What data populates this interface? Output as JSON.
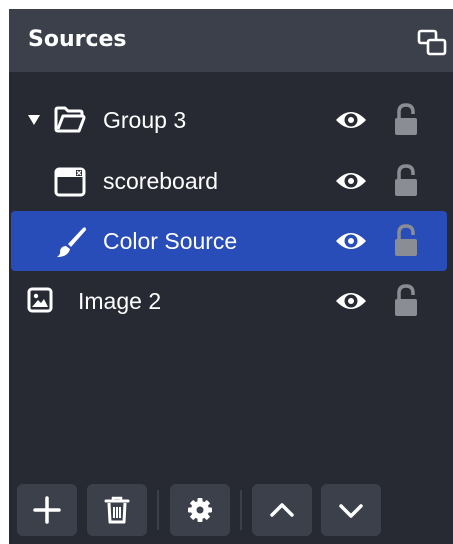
{
  "dock": {
    "title": "Sources",
    "undock_icon": "undock-icon"
  },
  "sources": [
    {
      "label": "Group 3",
      "icon": "folder-icon",
      "expander": "triangle-down-icon",
      "visible": true,
      "locked": false,
      "selected": false
    },
    {
      "label": "scoreboard",
      "icon": "window-icon",
      "visible": true,
      "locked": false,
      "selected": false
    },
    {
      "label": "Color Source",
      "icon": "brush-icon",
      "visible": true,
      "locked": false,
      "selected": true
    },
    {
      "label": "Image 2",
      "icon": "image-icon",
      "visible": true,
      "locked": false,
      "selected": false
    }
  ],
  "toolbar": [
    {
      "name": "add-source-button",
      "icon": "plus-icon"
    },
    {
      "name": "remove-source-button",
      "icon": "trash-icon"
    },
    {
      "name": "source-properties-button",
      "icon": "gear-icon"
    },
    {
      "name": "move-up-button",
      "icon": "chevron-up-icon"
    },
    {
      "name": "move-down-button",
      "icon": "chevron-down-icon"
    }
  ],
  "colors": {
    "dock_bg": "#272a33",
    "header_bg": "#3c404b",
    "selected_row": "#284cb8",
    "text": "#fefefe",
    "lock_icon": "#8b8d94"
  }
}
